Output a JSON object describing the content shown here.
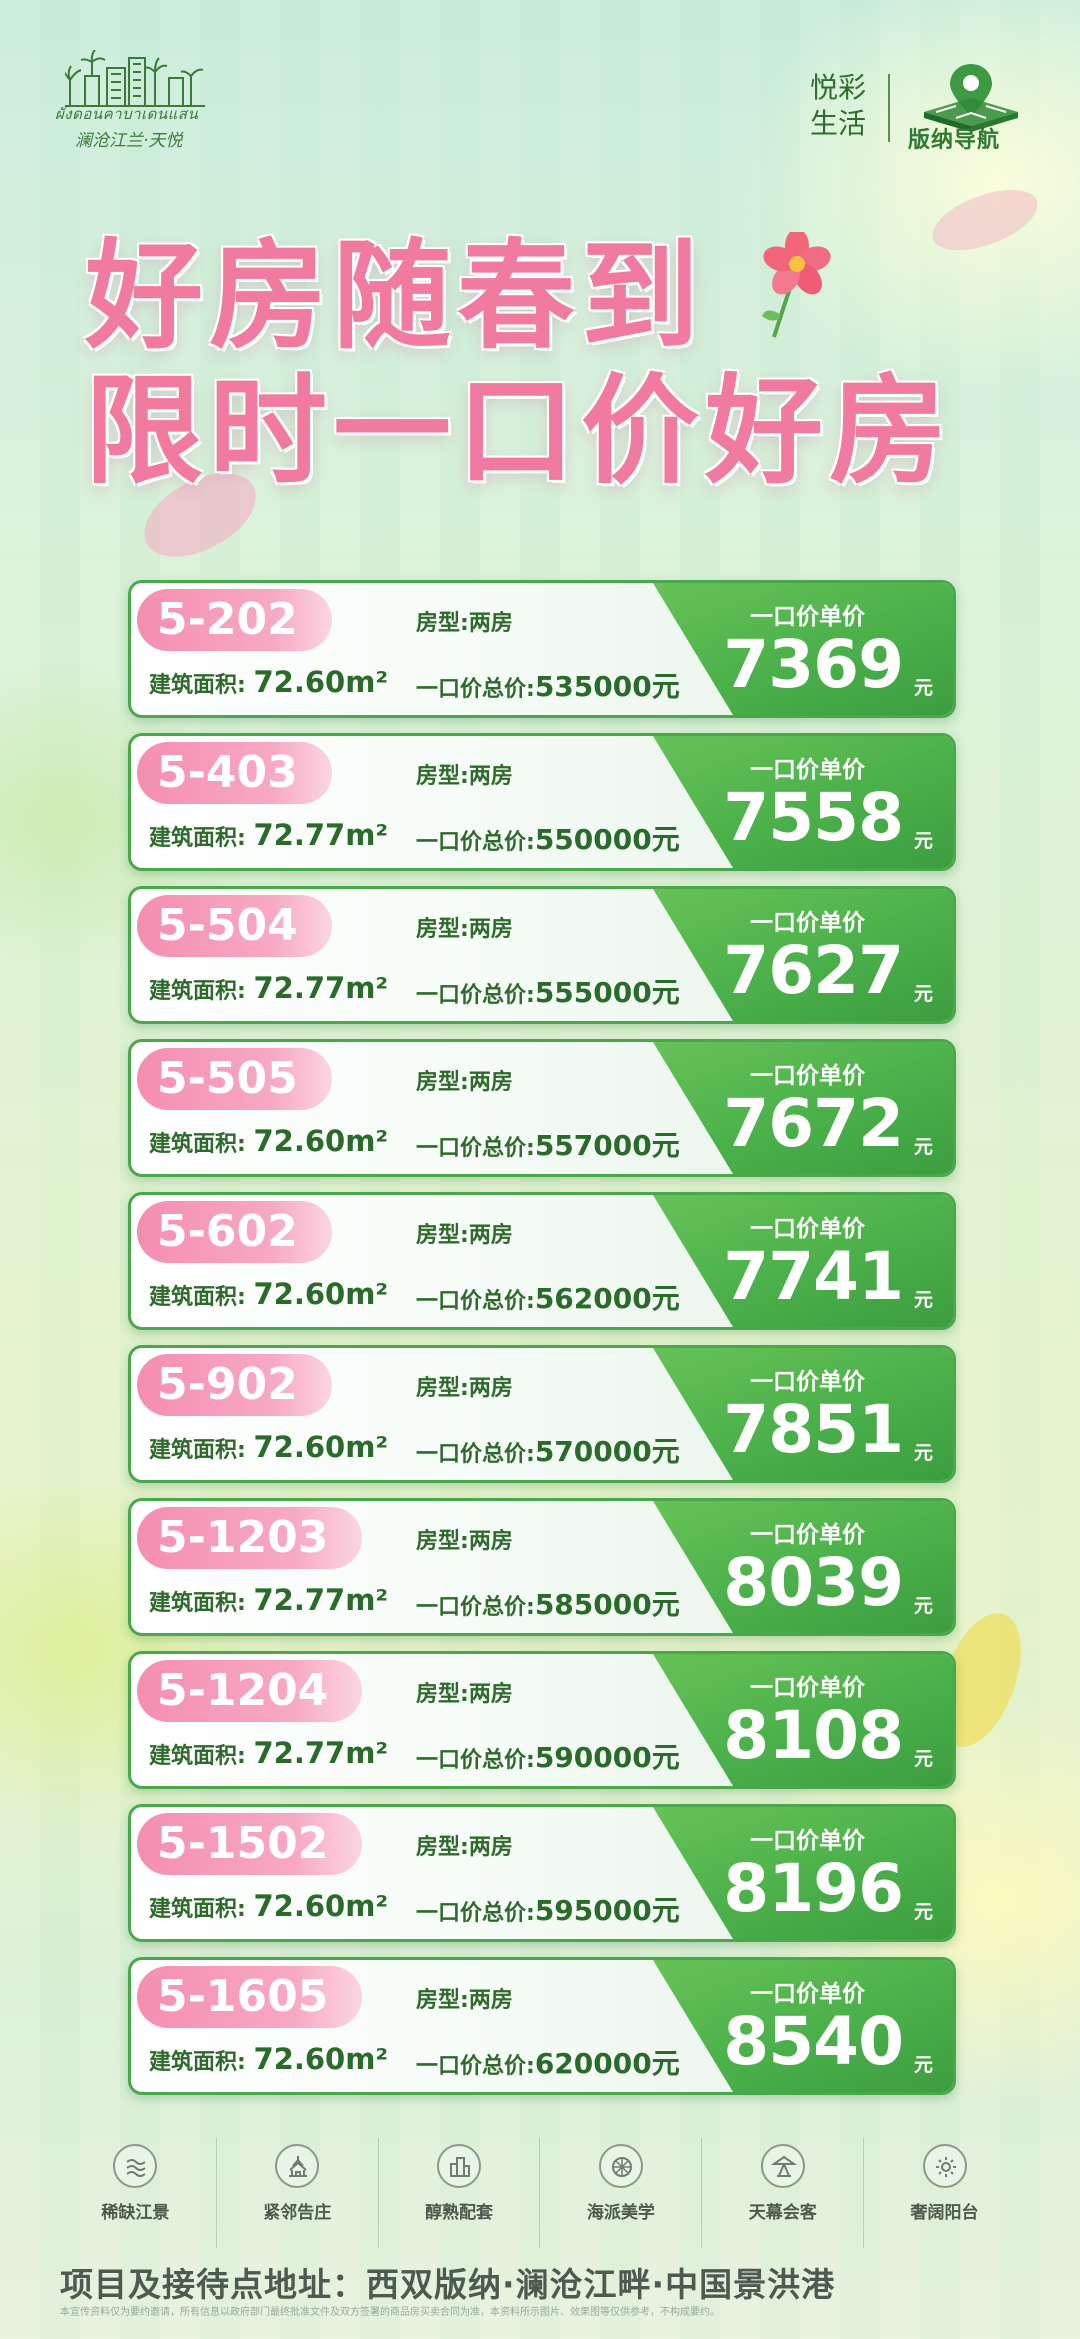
{
  "header": {
    "left_logo": {
      "script_text": "ผังดอนคาบาเดนแสน",
      "name": "澜沧江兰·天悦"
    },
    "right_logo": {
      "slogan": "悦彩生活",
      "brand_name": "版纳导航"
    }
  },
  "title": {
    "line1": "好房随春到",
    "line2": "限时一口价好房"
  },
  "labels": {
    "area_label": "建筑面积:",
    "type_label": "房型:",
    "total_label": "一口价总价:",
    "unit_price_title": "一口价单价",
    "unit_suffix": "元"
  },
  "listings": [
    {
      "room": "5-202",
      "type": "两房",
      "area": "72.60m²",
      "total": "535000元",
      "unit_price": "7369"
    },
    {
      "room": "5-403",
      "type": "两房",
      "area": "72.77m²",
      "total": "550000元",
      "unit_price": "7558"
    },
    {
      "room": "5-504",
      "type": "两房",
      "area": "72.77m²",
      "total": "555000元",
      "unit_price": "7627"
    },
    {
      "room": "5-505",
      "type": "两房",
      "area": "72.60m²",
      "total": "557000元",
      "unit_price": "7672"
    },
    {
      "room": "5-602",
      "type": "两房",
      "area": "72.60m²",
      "total": "562000元",
      "unit_price": "7741"
    },
    {
      "room": "5-902",
      "type": "两房",
      "area": "72.60m²",
      "total": "570000元",
      "unit_price": "7851"
    },
    {
      "room": "5-1203",
      "type": "两房",
      "area": "72.77m²",
      "total": "585000元",
      "unit_price": "8039"
    },
    {
      "room": "5-1204",
      "type": "两房",
      "area": "72.77m²",
      "total": "590000元",
      "unit_price": "8108"
    },
    {
      "room": "5-1502",
      "type": "两房",
      "area": "72.60m²",
      "total": "595000元",
      "unit_price": "8196"
    },
    {
      "room": "5-1605",
      "type": "两房",
      "area": "72.60m²",
      "total": "620000元",
      "unit_price": "8540"
    }
  ],
  "features": [
    {
      "label": "稀缺江景",
      "icon": "river-icon"
    },
    {
      "label": "紧邻告庄",
      "icon": "temple-icon"
    },
    {
      "label": "醇熟配套",
      "icon": "buildings-icon"
    },
    {
      "label": "海派美学",
      "icon": "aesthetic-icon"
    },
    {
      "label": "天幕会客",
      "icon": "canopy-icon"
    },
    {
      "label": "奢阔阳台",
      "icon": "balcony-icon"
    }
  ],
  "address": "项目及接待点地址：西双版纳·澜沧江畔·中国景洪港",
  "disclaimer": "本宣传资料仅为要约邀请，所有信息以政府部门最终批准文件及双方签署的商品房买卖合同为准，本资料所示图片、效果图等仅供参考，不构成要约。",
  "colors": {
    "title_pink": "#f07aa0",
    "price_green": "#4bb04a",
    "tag_pink": "#f58eb0",
    "text_green": "#2f6a2c"
  }
}
